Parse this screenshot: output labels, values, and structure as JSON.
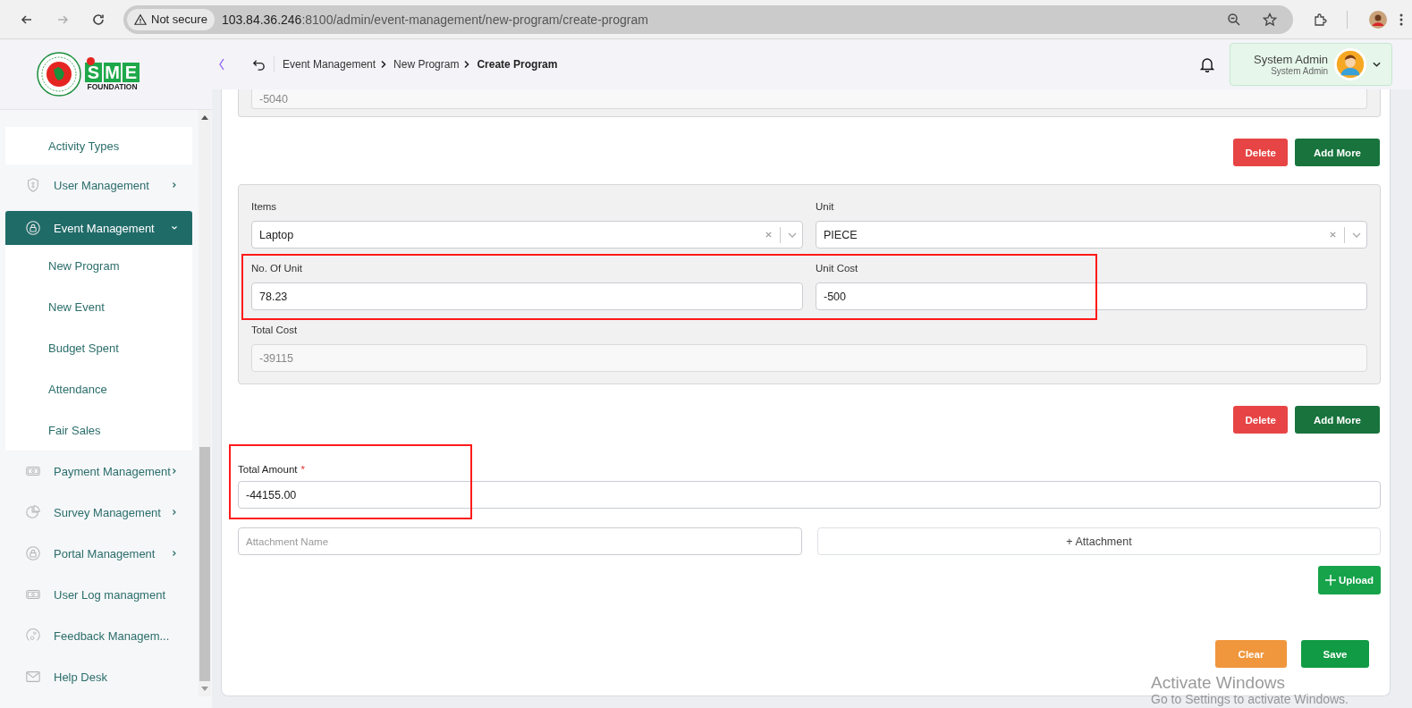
{
  "browser": {
    "forward_disabled": true,
    "security_label": "Not secure",
    "url_host": "103.84.36.246",
    "url_path": ":8100/admin/event-management/new-program/create-program"
  },
  "sidebar": {
    "items": [
      {
        "kind": "sub",
        "label": "Activity Types",
        "selected": false
      },
      {
        "kind": "group",
        "label": "User Management",
        "selected": false,
        "expanded": false
      },
      {
        "kind": "group",
        "label": "Event Management",
        "selected": true,
        "expanded": true,
        "children": [
          {
            "label": "New Program",
            "selected": false
          },
          {
            "label": "New Event",
            "selected": false
          },
          {
            "label": "Budget Spent",
            "selected": false
          },
          {
            "label": "Attendance",
            "selected": false
          },
          {
            "label": "Fair Sales",
            "selected": false
          }
        ]
      },
      {
        "kind": "group",
        "label": "Payment Management",
        "selected": false,
        "expanded": false
      },
      {
        "kind": "group",
        "label": "Survey Management",
        "selected": false,
        "expanded": false
      },
      {
        "kind": "group",
        "label": "Portal Management",
        "selected": false,
        "expanded": false
      },
      {
        "kind": "group",
        "label": "User Log managment",
        "selected": false
      },
      {
        "kind": "group",
        "label": "Feedback Managem...",
        "selected": false
      },
      {
        "kind": "group",
        "label": "Help Desk",
        "selected": false
      }
    ]
  },
  "logo": {
    "letters": [
      "S",
      "M",
      "E"
    ],
    "caption": "FOUNDATION"
  },
  "header": {
    "breadcrumb": [
      "Event Management",
      "New Program",
      "Create Program"
    ],
    "user": {
      "name": "System Admin",
      "role": "System Admin"
    }
  },
  "form": {
    "entries": [
      {
        "fields": [
          {
            "kind": "readonly",
            "value": "-5040"
          }
        ],
        "actions": [
          "Delete",
          "Add More"
        ]
      },
      {
        "fields": [
          {
            "kind": "select",
            "label": "Items",
            "value": "Laptop"
          },
          {
            "kind": "select",
            "label": "Unit",
            "value": "PIECE"
          },
          {
            "kind": "input",
            "label": "No. Of Unit",
            "value": "78.23"
          },
          {
            "kind": "input",
            "label": "Unit Cost",
            "value": "-500"
          },
          {
            "kind": "readonly",
            "label": "Total Cost",
            "value": "-39115"
          }
        ],
        "actions": [
          "Delete",
          "Add More"
        ]
      }
    ],
    "total_amount": {
      "label": "Total Amount",
      "required": true,
      "required_mark": "*",
      "value": "-44155.00"
    },
    "attachment": {
      "placeholder": "Attachment Name",
      "button": "+ Attachment",
      "upload": "Upload"
    },
    "footer": [
      "Clear",
      "Save"
    ]
  },
  "os_notice": {
    "title": "Activate Windows",
    "subtitle": "Go to Settings to activate Windows."
  }
}
